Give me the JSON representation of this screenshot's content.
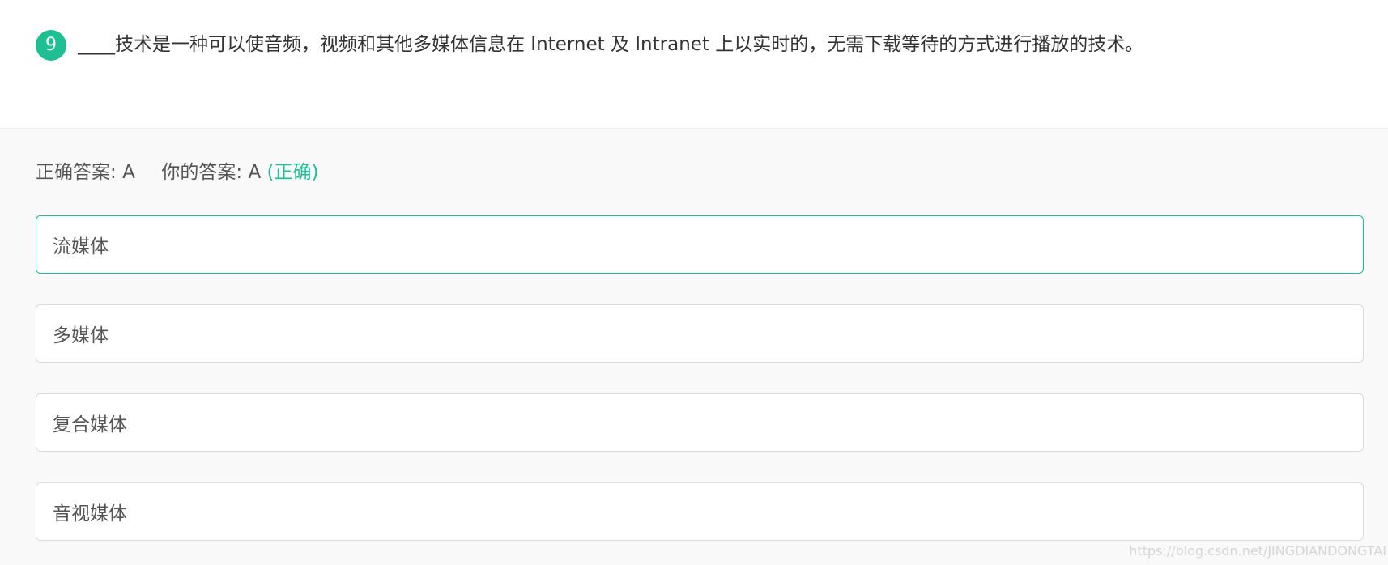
{
  "question": {
    "number": "9",
    "text": "____技术是一种可以使音频，视频和其他多媒体信息在 Internet 及 Intranet 上以实时的，无需下载等待的方式进行播放的技术。"
  },
  "answer": {
    "correct_label": "正确答案:",
    "correct_value": "A",
    "yours_label": "你的答案:",
    "yours_value": "A",
    "result": "(正确)"
  },
  "options": [
    {
      "label": "流媒体",
      "state": "correct"
    },
    {
      "label": "多媒体",
      "state": "normal"
    },
    {
      "label": "复合媒体",
      "state": "normal"
    },
    {
      "label": "音视媒体",
      "state": "normal"
    }
  ],
  "watermark": "https://blog.csdn.net/JINGDIANDONGTAI",
  "colors": {
    "accent": "#1fbf94",
    "option_border": "#dcdcdc"
  }
}
